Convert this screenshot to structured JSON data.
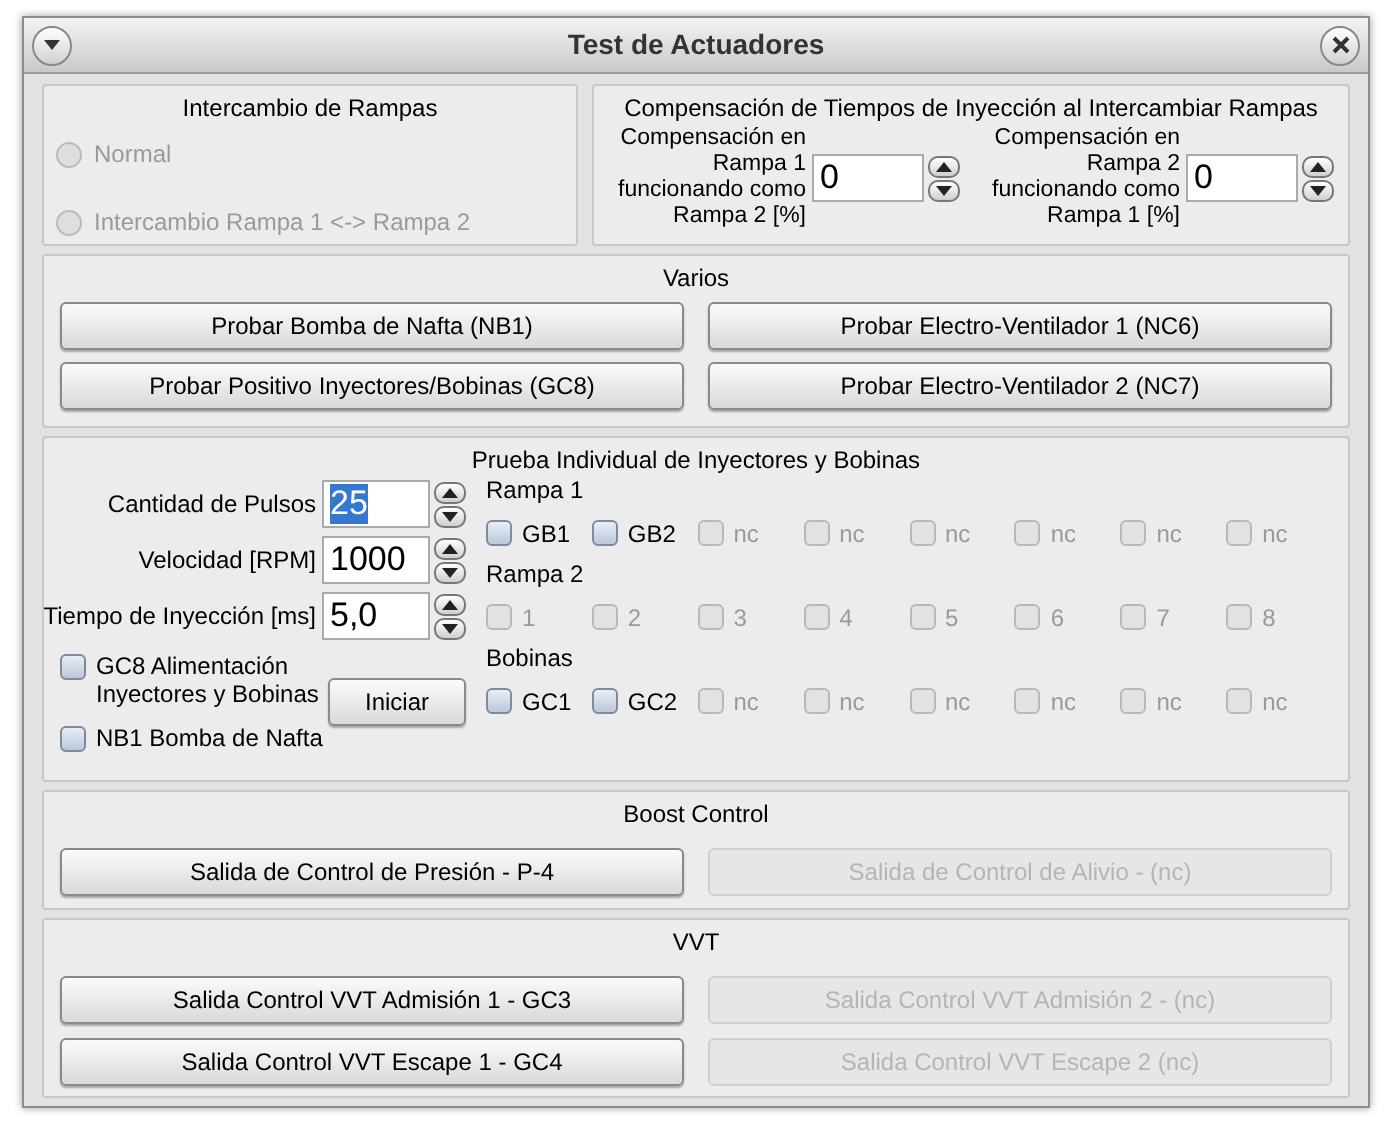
{
  "window": {
    "title": "Test de Actuadores"
  },
  "swap": {
    "title": "Intercambio de Rampas",
    "options": [
      {
        "label": "Normal",
        "selected": false,
        "disabled": true
      },
      {
        "label": "Intercambio Rampa 1 <-> Rampa 2",
        "selected": false,
        "disabled": true
      }
    ]
  },
  "compensation": {
    "title": "Compensación de Tiempos de Inyección al Intercambiar Rampas",
    "fields": [
      {
        "label": "Compensación en Rampa 1 funcionando como Rampa 2 [%]",
        "value": "0"
      },
      {
        "label": "Compensación en Rampa 2 funcionando como Rampa 1 [%]",
        "value": "0"
      }
    ]
  },
  "varios": {
    "title": "Varios",
    "buttons": [
      {
        "label": "Probar Bomba de Nafta (NB1)",
        "disabled": false
      },
      {
        "label": "Probar Electro-Ventilador 1 (NC6)",
        "disabled": false
      },
      {
        "label": "Probar Positivo Inyectores/Bobinas (GC8)",
        "disabled": false
      },
      {
        "label": "Probar Electro-Ventilador 2 (NC7)",
        "disabled": false
      }
    ]
  },
  "individual": {
    "title": "Prueba Individual de Inyectores y Bobinas",
    "inputs": [
      {
        "label": "Cantidad de Pulsos",
        "value": "25",
        "selected": true
      },
      {
        "label": "Velocidad [RPM]",
        "value": "1000",
        "selected": false
      },
      {
        "label": "Tiempo de Inyección [ms]",
        "value": "5,0",
        "selected": false
      }
    ],
    "checks": [
      {
        "label": "GC8 Alimentación Inyectores y Bobinas",
        "checked": false
      },
      {
        "label": "NB1 Bomba de Nafta",
        "checked": false
      }
    ],
    "start_button": "Iniciar",
    "sections": [
      {
        "title": "Rampa 1",
        "items": [
          {
            "label": "GB1",
            "checked": false,
            "disabled": false
          },
          {
            "label": "GB2",
            "checked": false,
            "disabled": false
          },
          {
            "label": "nc",
            "checked": false,
            "disabled": true
          },
          {
            "label": "nc",
            "checked": false,
            "disabled": true
          },
          {
            "label": "nc",
            "checked": false,
            "disabled": true
          },
          {
            "label": "nc",
            "checked": false,
            "disabled": true
          },
          {
            "label": "nc",
            "checked": false,
            "disabled": true
          },
          {
            "label": "nc",
            "checked": false,
            "disabled": true
          }
        ]
      },
      {
        "title": "Rampa 2",
        "items": [
          {
            "label": "1",
            "checked": false,
            "disabled": true
          },
          {
            "label": "2",
            "checked": false,
            "disabled": true
          },
          {
            "label": "3",
            "checked": false,
            "disabled": true
          },
          {
            "label": "4",
            "checked": false,
            "disabled": true
          },
          {
            "label": "5",
            "checked": false,
            "disabled": true
          },
          {
            "label": "6",
            "checked": false,
            "disabled": true
          },
          {
            "label": "7",
            "checked": false,
            "disabled": true
          },
          {
            "label": "8",
            "checked": false,
            "disabled": true
          }
        ]
      },
      {
        "title": "Bobinas",
        "items": [
          {
            "label": "GC1",
            "checked": false,
            "disabled": false
          },
          {
            "label": "GC2",
            "checked": false,
            "disabled": false
          },
          {
            "label": "nc",
            "checked": false,
            "disabled": true
          },
          {
            "label": "nc",
            "checked": false,
            "disabled": true
          },
          {
            "label": "nc",
            "checked": false,
            "disabled": true
          },
          {
            "label": "nc",
            "checked": false,
            "disabled": true
          },
          {
            "label": "nc",
            "checked": false,
            "disabled": true
          },
          {
            "label": "nc",
            "checked": false,
            "disabled": true
          }
        ]
      }
    ]
  },
  "boost": {
    "title": "Boost Control",
    "buttons": [
      {
        "label": "Salida de Control de Presión - P-4",
        "disabled": false
      },
      {
        "label": "Salida de Control de Alivio - (nc)",
        "disabled": true
      }
    ]
  },
  "vvt": {
    "title": "VVT",
    "buttons": [
      {
        "label": "Salida Control VVT Admisión 1 - GC3",
        "disabled": false
      },
      {
        "label": "Salida Control VVT Admisión 2 - (nc)",
        "disabled": true
      },
      {
        "label": "Salida Control VVT Escape 1 - GC4",
        "disabled": false
      },
      {
        "label": "Salida Control VVT Escape 2 (nc)",
        "disabled": true
      }
    ]
  }
}
